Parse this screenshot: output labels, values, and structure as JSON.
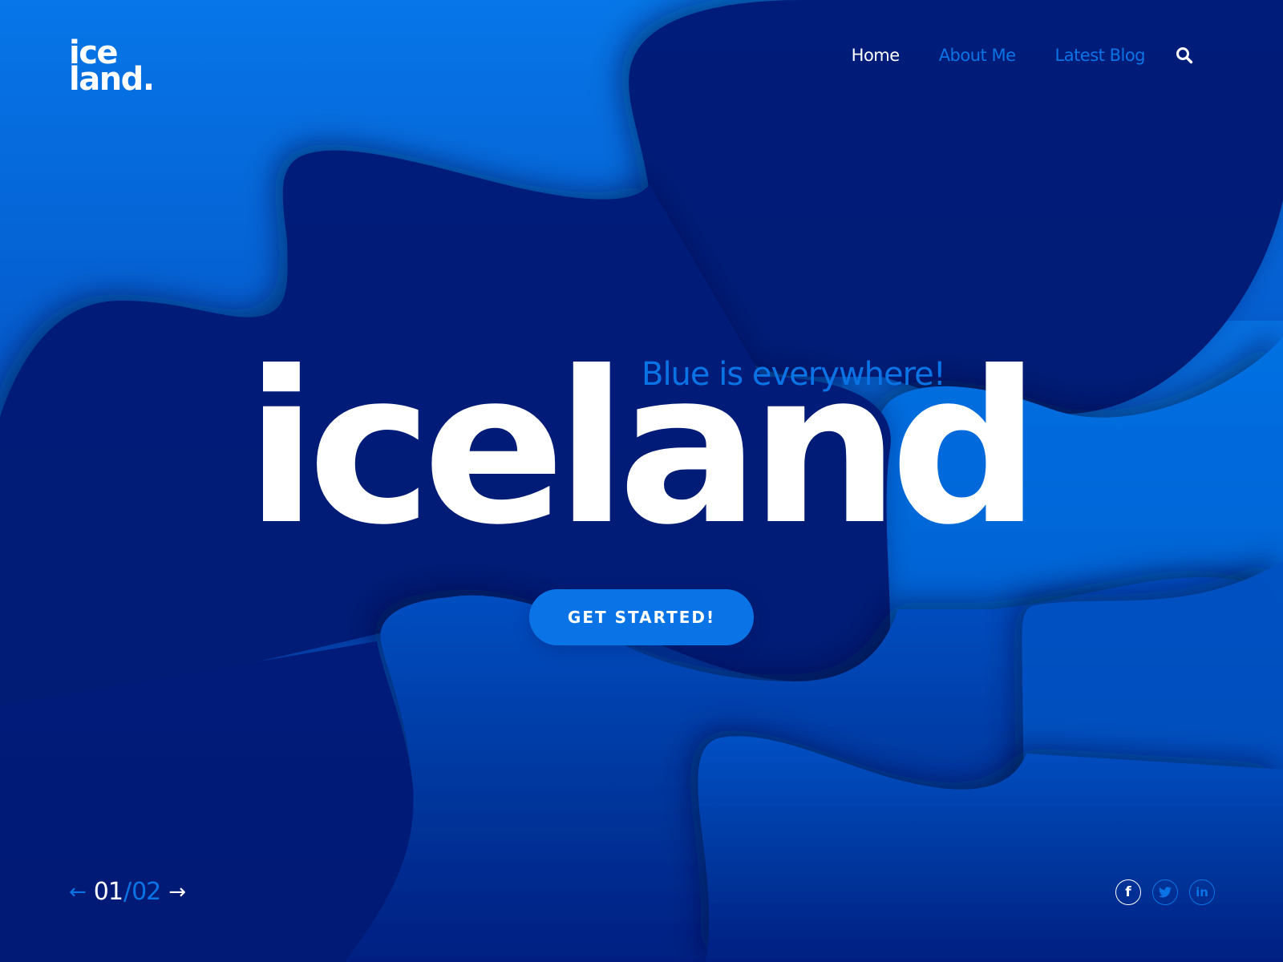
{
  "brand": {
    "logo_line1": "ice",
    "logo_line2": "land."
  },
  "nav": {
    "items": [
      {
        "label": "Home",
        "active": true
      },
      {
        "label": "About Me",
        "active": false
      },
      {
        "label": "Latest Blog",
        "active": false
      }
    ],
    "search_icon": "search-icon"
  },
  "hero": {
    "tagline": "Blue is everywhere!",
    "title": "iceland",
    "cta_label": "GET STARTED!"
  },
  "pager": {
    "prev_icon": "arrow-left-icon",
    "current": "01",
    "separator": "/",
    "total": "02",
    "next_icon": "arrow-right-icon"
  },
  "social": {
    "items": [
      {
        "name": "facebook",
        "glyph": "f"
      },
      {
        "name": "twitter",
        "glyph": "twitter-bird"
      },
      {
        "name": "linkedin",
        "glyph": "in"
      }
    ]
  },
  "colors": {
    "accent": "#0a74e6",
    "deep_navy": "#001a78",
    "bright_blue": "#0673e4",
    "text": "#ffffff"
  }
}
